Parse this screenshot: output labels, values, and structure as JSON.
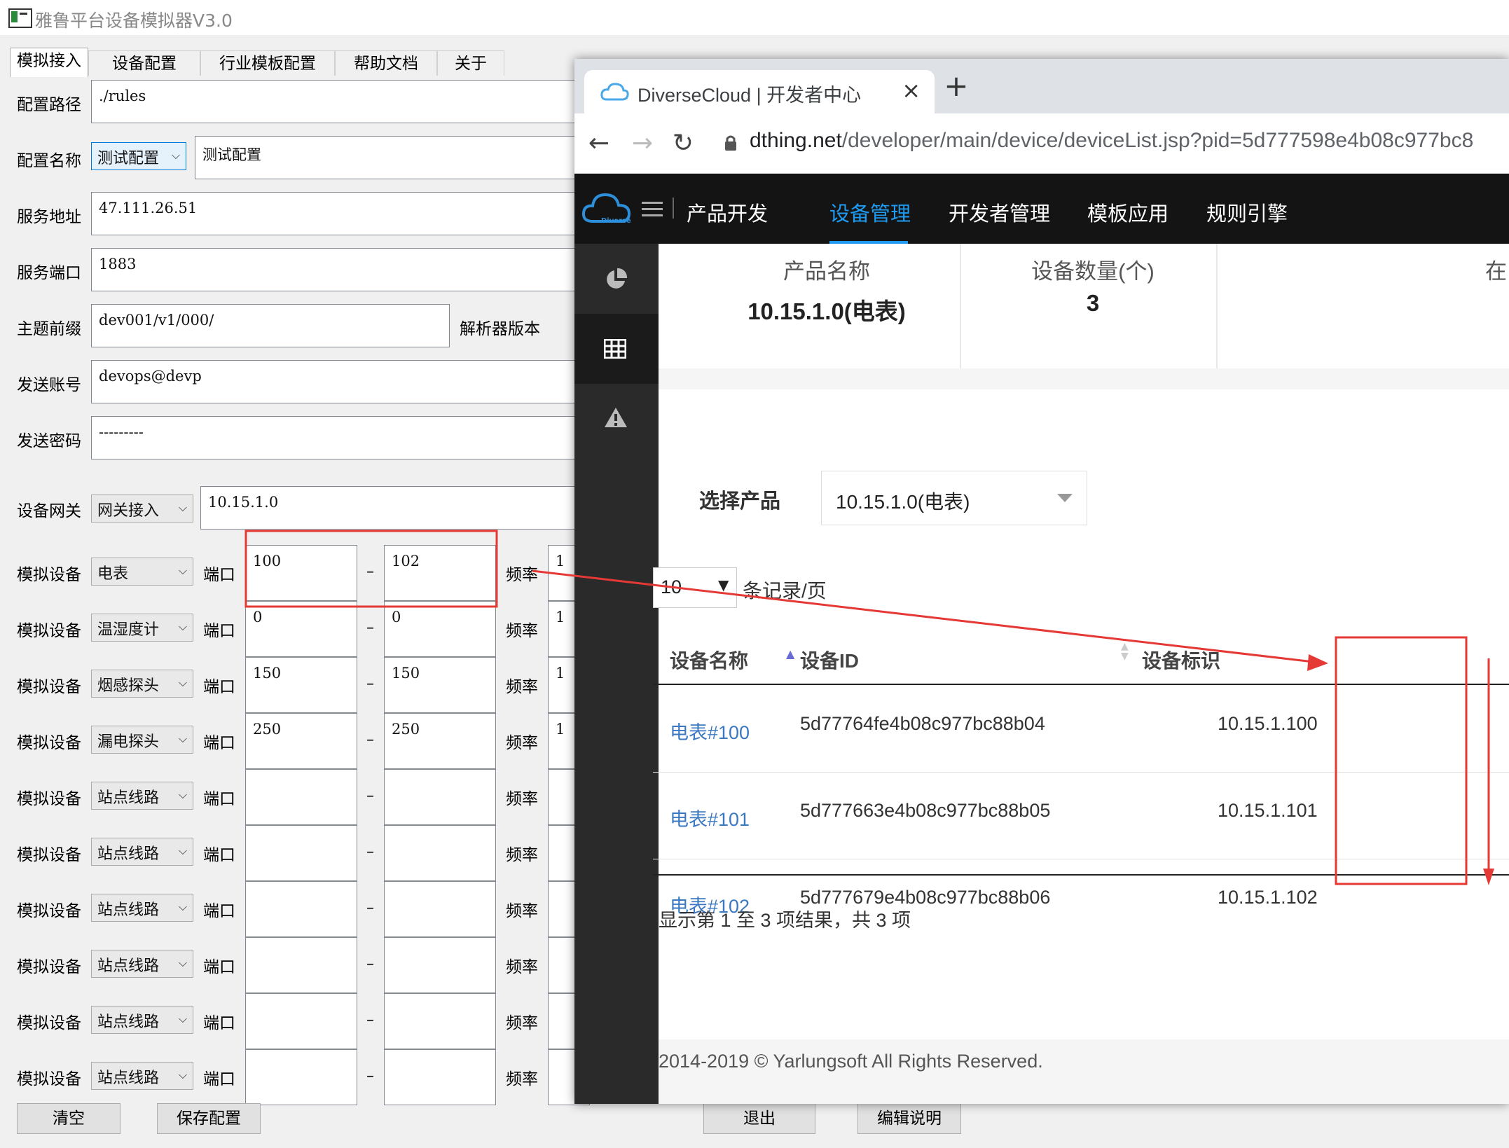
{
  "app": {
    "title": "雅鲁平台设备模拟器V3.0",
    "tabs": [
      "模拟接入",
      "设备配置",
      "行业模板配置",
      "帮助文档",
      "关于"
    ],
    "fields": {
      "config_path_label": "配置路径",
      "config_path_value": "./rules",
      "config_name_label": "配置名称",
      "config_name_select": "测试配置",
      "config_name_value": "测试配置",
      "server_addr_label": "服务地址",
      "server_addr_value": "47.111.26.51",
      "server_port_label": "服务端口",
      "server_port_value": "1883",
      "topic_prefix_label": "主题前缀",
      "topic_prefix_value": "dev001/v1/000/",
      "parser_version_label": "解析器版本",
      "send_account_label": "发送账号",
      "send_account_value": "devops@devp",
      "send_password_label": "发送密码",
      "send_password_value": "---------",
      "gateway_label": "设备网关",
      "gateway_select": "网关接入",
      "gateway_value": "10.15.1.0"
    },
    "device_row_label": "模拟设备",
    "port_label": "端口",
    "freq_label": "频率",
    "dash": "–",
    "devices": [
      {
        "type": "电表",
        "from": "100",
        "to": "102",
        "freq": "1"
      },
      {
        "type": "温湿度计",
        "from": "0",
        "to": "0",
        "freq": "1"
      },
      {
        "type": "烟感探头",
        "from": "150",
        "to": "150",
        "freq": "1"
      },
      {
        "type": "漏电探头",
        "from": "250",
        "to": "250",
        "freq": "1"
      },
      {
        "type": "站点线路",
        "from": "",
        "to": "",
        "freq": ""
      },
      {
        "type": "站点线路",
        "from": "",
        "to": "",
        "freq": ""
      },
      {
        "type": "站点线路",
        "from": "",
        "to": "",
        "freq": ""
      },
      {
        "type": "站点线路",
        "from": "",
        "to": "",
        "freq": ""
      },
      {
        "type": "站点线路",
        "from": "",
        "to": "",
        "freq": ""
      },
      {
        "type": "站点线路",
        "from": "",
        "to": "",
        "freq": ""
      }
    ],
    "buttons": {
      "clear": "清空",
      "save": "保存配置",
      "exit": "退出",
      "edit": "编辑说明"
    }
  },
  "browser": {
    "tab_title": "DiverseCloud | 开发者中心",
    "tab_close": "×",
    "new_tab": "+",
    "url_host": "dthing.net",
    "url_path": "/developer/main/device/deviceList.jsp?pid=5d777598e4b08c977bc8",
    "logo_text": "Diverse",
    "nav": [
      "产品开发",
      "设备管理",
      "开发者管理",
      "模板应用",
      "规则引擎"
    ],
    "nav_active": 1,
    "stats": [
      {
        "label": "产品名称",
        "value": "10.15.1.0(电表)"
      },
      {
        "label": "设备数量(个)",
        "value": "3"
      },
      {
        "label": "在",
        "value": ""
      }
    ],
    "select_product_label": "选择产品",
    "select_product_value": "10.15.1.0(电表)",
    "page_size": "10",
    "page_size_suffix": "条记录/页",
    "columns": [
      "设备名称",
      "设备ID",
      "设备标识"
    ],
    "rows": [
      {
        "name": "电表#100",
        "id": "5d77764fe4b08c977bc88b04",
        "ident": "10.15.1.100"
      },
      {
        "name": "电表#101",
        "id": "5d777663e4b08c977bc88b05",
        "ident": "10.15.1.101"
      },
      {
        "name": "电表#102",
        "id": "5d777679e4b08c977bc88b06",
        "ident": "10.15.1.102"
      }
    ],
    "summary": "显示第 1 至 3 项结果，共 3 项",
    "footer": "2014-2019 © Yarlungsoft All Rights Reserved."
  },
  "colors": {
    "accent": "#1e9bf0",
    "annotation": "#e53935",
    "nav_bg": "#141414",
    "sidebar_bg": "#2a2a2a"
  }
}
